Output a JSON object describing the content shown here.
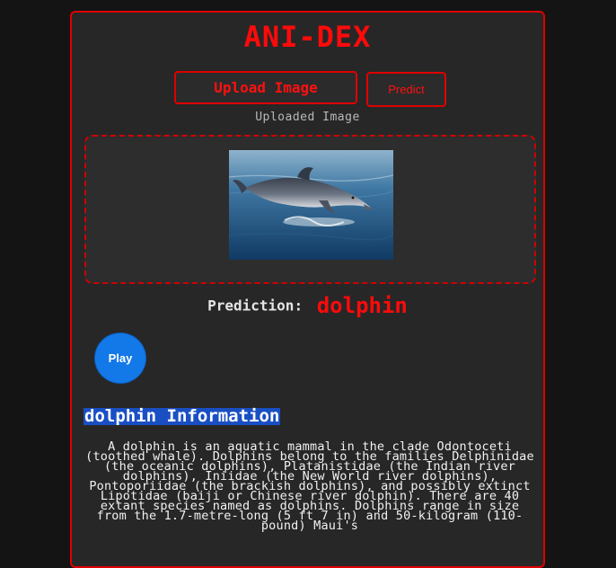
{
  "app": {
    "title": "ANI-DEX"
  },
  "toolbar": {
    "upload_label": "Upload Image",
    "predict_label": "Predict"
  },
  "upload": {
    "section_label": "Uploaded Image",
    "image_alt": "dolphin"
  },
  "prediction": {
    "label": "Prediction:",
    "value": "dolphin"
  },
  "audio": {
    "play_label": "Play"
  },
  "info": {
    "heading": "dolphin Information",
    "text": "A dolphin is an aquatic mammal in the clade Odontoceti (toothed whale). Dolphins belong to the families Delphinidae (the oceanic dolphins), Platanistidae (the Indian river dolphins), Iniidae (the New World river dolphins), Pontoporiidae (the brackish dolphins), and possibly extinct Lipotidae (baiji or Chinese river dolphin). There are 40 extant species named as dolphins. Dolphins range in size from the 1.7-metre-long (5 ft 7 in) and 50-kilogram (110-pound) Maui's"
  },
  "colors": {
    "accent": "#ff0a0a",
    "panel": "#272727",
    "page": "#141414",
    "play": "#1378e8",
    "heading_highlight": "#1a4fc4"
  }
}
